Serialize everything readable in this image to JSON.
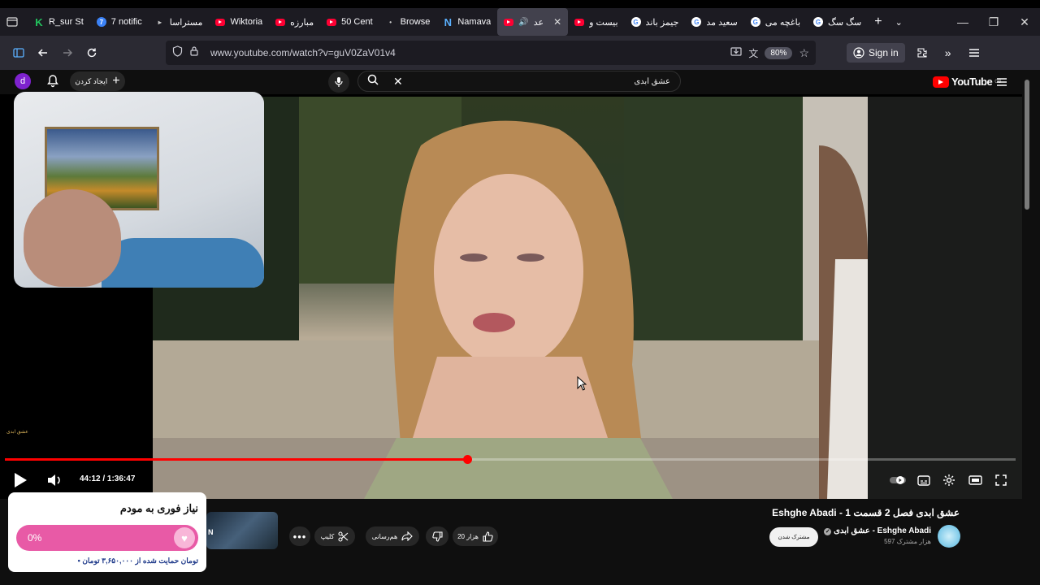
{
  "browser": {
    "tabs": [
      {
        "label": "R_sur St",
        "icon": "kick-icon",
        "fav": "k",
        "favText": "K"
      },
      {
        "label": "7 notific",
        "icon": "notification-icon",
        "fav": "seven",
        "favText": "7"
      },
      {
        "label": "مستراسا",
        "icon": "dot-icon",
        "fav": "dot",
        "favText": "▸"
      },
      {
        "label": "Wiktoria",
        "icon": "youtube-icon",
        "fav": "yt",
        "favText": ""
      },
      {
        "label": "مبارزه",
        "icon": "youtube-icon",
        "fav": "yt",
        "favText": ""
      },
      {
        "label": "50 Cent",
        "icon": "youtube-icon",
        "fav": "yt",
        "favText": ""
      },
      {
        "label": "Browse",
        "icon": "dot-icon",
        "fav": "dot",
        "favText": "•"
      },
      {
        "label": "Namava",
        "icon": "namava-icon",
        "fav": "n",
        "favText": "N"
      },
      {
        "label": "عد",
        "icon": "youtube-icon",
        "fav": "yt",
        "favText": "",
        "active": true
      },
      {
        "label": "بیست و",
        "icon": "youtube-icon",
        "fav": "yt",
        "favText": ""
      },
      {
        "label": "جیمز باند",
        "icon": "google-icon",
        "fav": "g",
        "favText": "G"
      },
      {
        "label": "سعید مد",
        "icon": "google-icon",
        "fav": "g",
        "favText": "G"
      },
      {
        "label": "باغچه می",
        "icon": "google-icon",
        "fav": "g",
        "favText": "G"
      },
      {
        "label": "سگ سگ",
        "icon": "google-icon",
        "fav": "g",
        "favText": "G"
      }
    ],
    "url": "www.youtube.com/watch?v=guV0ZaV01v4",
    "zoom": "80%",
    "signin": "Sign in"
  },
  "youtube": {
    "avatar_letter": "d",
    "create_label": "ایجاد کردن",
    "search_value": "عشق ابدی",
    "logo_text": "YouTube",
    "logo_region": "GB"
  },
  "player": {
    "time": "44:12 / 1:36:47",
    "progress": 0.457,
    "watermark": "عشق ابدی"
  },
  "video": {
    "title": "Eshghe Abadi - عشق ابدی فصل 2 قسمت 1",
    "channel": "عشق ابدی - Eshghe Abadi",
    "subs": "597 هزار مشترک",
    "subscribe": "مشترک شدن",
    "likes": "20 هزار",
    "share": "هم‌رسانی",
    "clip": "کلیپ",
    "thumb_letter": "N"
  },
  "donation": {
    "title": "نیاز فوری به مودم",
    "percent": "0%",
    "progress": 0,
    "subtitle": "• تومان حمایت شده از ۳,۶۵۰,۰۰۰ تومان",
    "accent": "#e85aa6"
  }
}
